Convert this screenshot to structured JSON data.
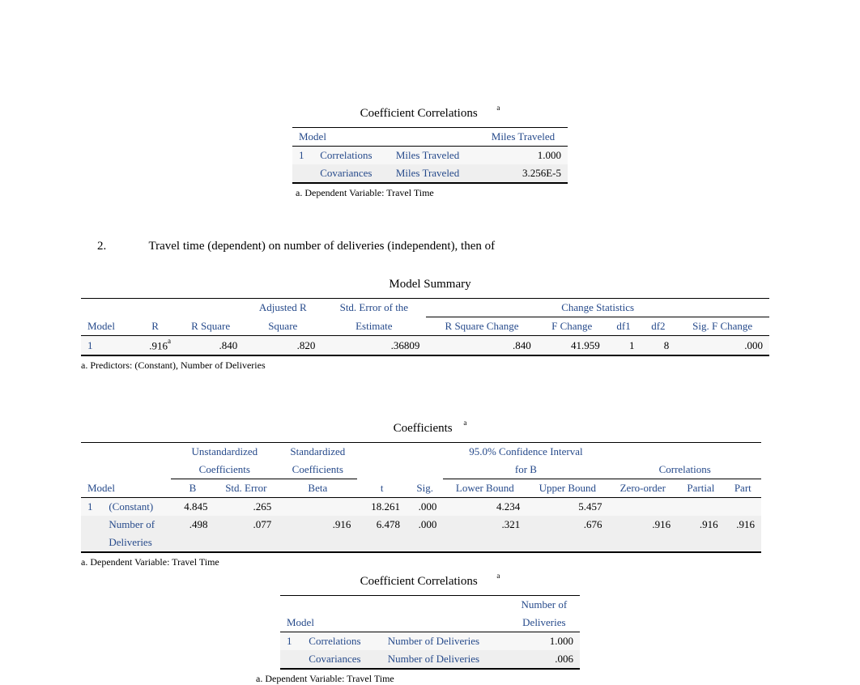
{
  "cc1": {
    "title": "Coefficient Correlations",
    "sup": "a",
    "col_model": "Model",
    "col_var": "Miles Traveled",
    "model_num": "1",
    "row1_a": "Correlations",
    "row1_b": "Miles Traveled",
    "row1_val": "1.000",
    "row2_a": "Covariances",
    "row2_b": "Miles Traveled",
    "row2_val": "3.256E-5",
    "footnote": "a. Dependent Variable: Travel Time"
  },
  "section": {
    "num": "2.",
    "text": "Travel time (dependent) on number of deliveries (independent), then of"
  },
  "ms": {
    "title": "Model Summary",
    "h_model": "Model",
    "h_r": "R",
    "h_rsq": "R Square",
    "h_adjr1": "Adjusted R",
    "h_adjr2": "Square",
    "h_se1": "Std. Error of the",
    "h_se2": "Estimate",
    "h_change": "Change Statistics",
    "h_rsqch": "R Square Change",
    "h_fch": "F Change",
    "h_df1": "df1",
    "h_df2": "df2",
    "h_sigf": "Sig. F Change",
    "model": "1",
    "r": ".916",
    "r_sup": "a",
    "rsq": ".840",
    "adjr": ".820",
    "se": ".36809",
    "rsqch": ".840",
    "fch": "41.959",
    "df1": "1",
    "df2": "8",
    "sigf": ".000",
    "footnote": "a. Predictors: (Constant), Number of Deliveries"
  },
  "coef": {
    "title": "Coefficients",
    "sup": "a",
    "h_unstd1": "Unstandardized",
    "h_unstd2": "Coefficients",
    "h_std1": "Standardized",
    "h_std2": "Coefficients",
    "h_ci1": "95.0% Confidence Interval",
    "h_ci2": "for B",
    "h_corr": "Correlations",
    "h_model": "Model",
    "h_b": "B",
    "h_se": "Std. Error",
    "h_beta": "Beta",
    "h_t": "t",
    "h_sig": "Sig.",
    "h_lb": "Lower Bound",
    "h_ub": "Upper Bound",
    "h_zo": "Zero-order",
    "h_part": "Partial",
    "h_pt": "Part",
    "model": "1",
    "r1_lbl": "(Constant)",
    "r1_b": "4.845",
    "r1_se": ".265",
    "r1_beta": "",
    "r1_t": "18.261",
    "r1_sig": ".000",
    "r1_lb": "4.234",
    "r1_ub": "5.457",
    "r2_lbl1": "Number of",
    "r2_lbl2": "Deliveries",
    "r2_b": ".498",
    "r2_se": ".077",
    "r2_beta": ".916",
    "r2_t": "6.478",
    "r2_sig": ".000",
    "r2_lb": ".321",
    "r2_ub": ".676",
    "r2_zo": ".916",
    "r2_part": ".916",
    "r2_pt": ".916",
    "footnote": "a. Dependent Variable: Travel Time"
  },
  "cc2": {
    "title": "Coefficient Correlations",
    "sup": "a",
    "col_model": "Model",
    "col_var1": "Number of",
    "col_var2": "Deliveries",
    "model_num": "1",
    "row1_a": "Correlations",
    "row1_b": "Number of Deliveries",
    "row1_val": "1.000",
    "row2_a": "Covariances",
    "row2_b": "Number of Deliveries",
    "row2_val": ".006",
    "footnote": "a. Dependent Variable: Travel Time"
  }
}
